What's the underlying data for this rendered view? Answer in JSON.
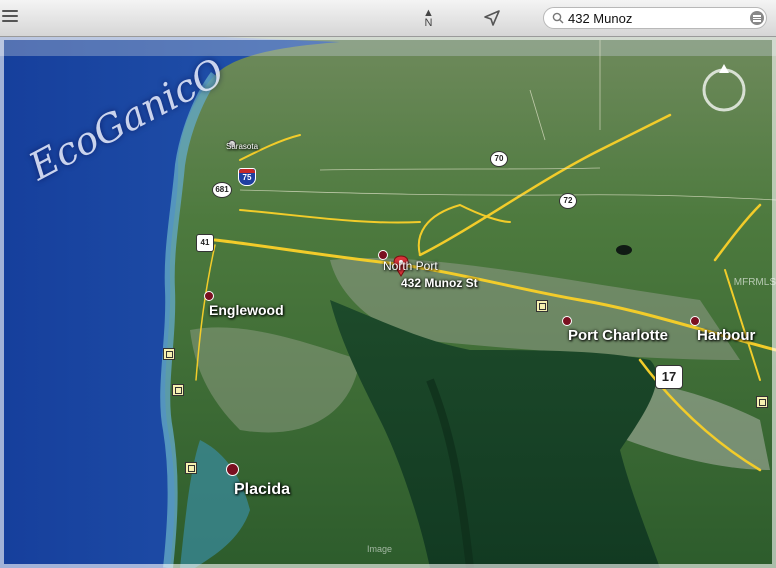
{
  "toolbar": {
    "north_label": "N",
    "search_value": "432 Munoz"
  },
  "brand_text": "EcoGanicO",
  "places": {
    "north_port": "North Port",
    "address": "432 Munoz St",
    "englewood": "Englewood",
    "port_charlotte": "Port Charlotte",
    "harbour": "Harbour",
    "placida": "Placida",
    "sarasota": "Sarasota"
  },
  "shields": {
    "i75": "75",
    "r681": "681",
    "r41": "41",
    "r70": "70",
    "r72": "72",
    "r17": "17"
  },
  "watermark": "MFRMLS",
  "credit": "Image",
  "colors": {
    "road": "#f2cc2a",
    "pin": "#d8333a",
    "water_deep": "#1f4fae",
    "water_shallow": "#3d8fb0"
  }
}
